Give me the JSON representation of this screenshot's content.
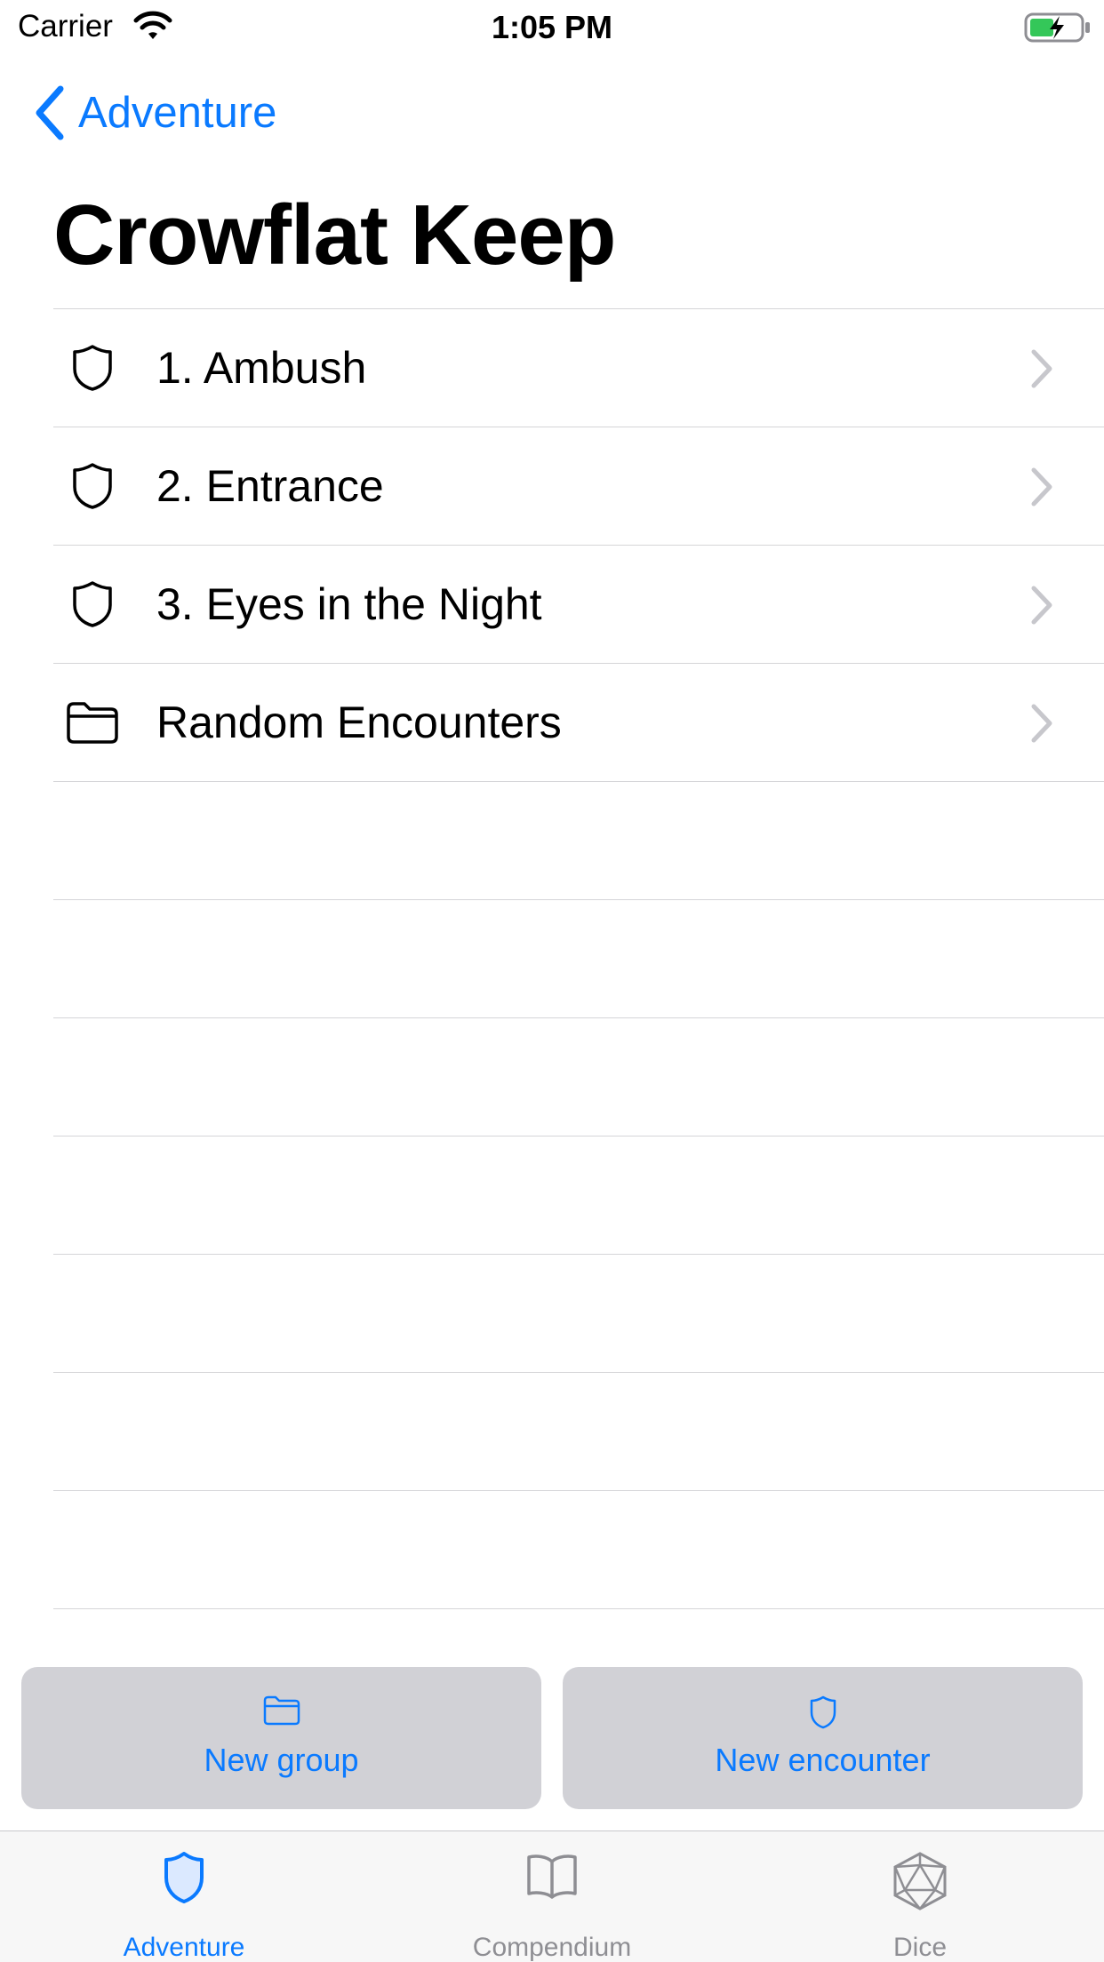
{
  "status_bar": {
    "carrier": "Carrier",
    "time": "1:05 PM"
  },
  "nav": {
    "back_label": "Adventure"
  },
  "title": "Crowflat Keep",
  "items": [
    {
      "label": "1. Ambush",
      "icon": "shield-icon"
    },
    {
      "label": "2. Entrance",
      "icon": "shield-icon"
    },
    {
      "label": "3. Eyes in the Night",
      "icon": "shield-icon"
    },
    {
      "label": "Random Encounters",
      "icon": "folder-icon"
    }
  ],
  "actions": {
    "new_group": "New group",
    "new_encounter": "New encounter"
  },
  "tabs": [
    {
      "label": "Adventure",
      "icon": "shield-icon",
      "selected": true
    },
    {
      "label": "Compendium",
      "icon": "book-icon",
      "selected": false
    },
    {
      "label": "Dice",
      "icon": "dice-icon",
      "selected": false
    }
  ],
  "colors": {
    "accent": "#0a7aff",
    "inactive": "#8e8e93",
    "button_bg": "#d1d1d6",
    "separator": "#d5d5d8"
  }
}
